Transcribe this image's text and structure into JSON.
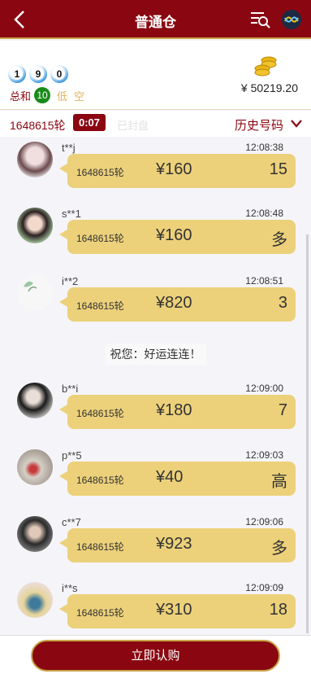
{
  "header": {
    "title": "普通仓"
  },
  "info": {
    "balls": [
      "1",
      "9",
      "0"
    ],
    "sum_label": "总和",
    "sum_value": "10",
    "tag_low": "低",
    "tag_empty": "空",
    "balance": "¥ 50219.20"
  },
  "round": {
    "id": "1648615轮",
    "countdown": "0:07",
    "status": "已封盘",
    "history_label": "历史号码"
  },
  "messages": [
    {
      "user": "t**j",
      "time": "12:08:38",
      "round": "1648615轮",
      "amount": "¥160",
      "bet": "15"
    },
    {
      "user": "s**1",
      "time": "12:08:48",
      "round": "1648615轮",
      "amount": "¥160",
      "bet": "多"
    },
    {
      "user": "i**2",
      "time": "12:08:51",
      "round": "1648615轮",
      "amount": "¥820",
      "bet": "3"
    },
    {
      "user": "b**i",
      "time": "12:09:00",
      "round": "1648615轮",
      "amount": "¥180",
      "bet": "7"
    },
    {
      "user": "p**5",
      "time": "12:09:03",
      "round": "1648615轮",
      "amount": "¥40",
      "bet": "高"
    },
    {
      "user": "c**7",
      "time": "12:09:06",
      "round": "1648615轮",
      "amount": "¥923",
      "bet": "多"
    },
    {
      "user": "i**s",
      "time": "12:09:09",
      "round": "1648615轮",
      "amount": "¥310",
      "bet": "18"
    }
  ],
  "notice": "祝您：好运连连！",
  "footer": {
    "buy_label": "立即认购"
  },
  "colors": {
    "brand": "#8a0712",
    "gold": "#c9a54a",
    "bubble": "#ecd07a",
    "sum_green": "#1a8a1a"
  }
}
